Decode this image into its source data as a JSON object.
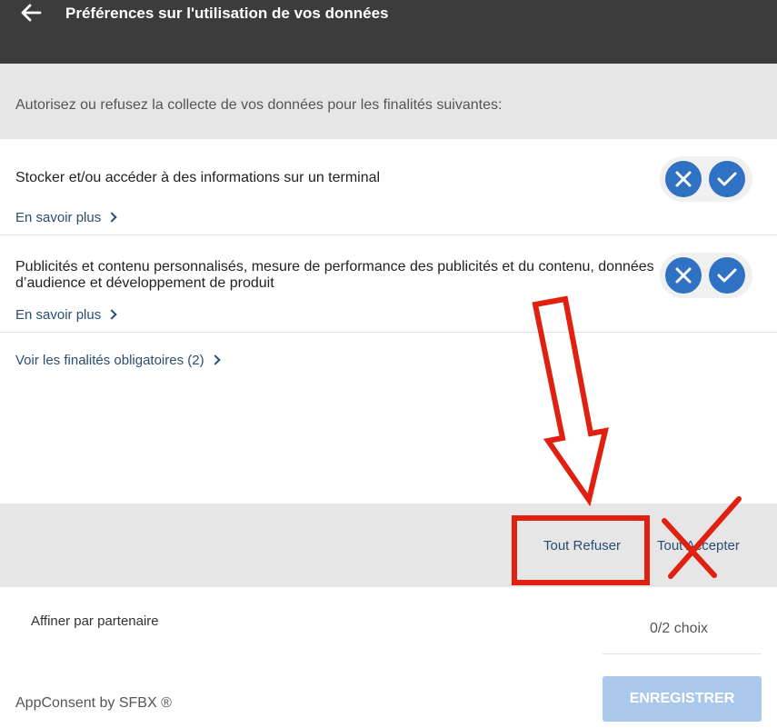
{
  "header": {
    "back_icon": "arrow-left-icon",
    "title": "Préférences sur l'utilisation de vos données",
    "background_color": "#3c3c3c"
  },
  "intro": {
    "text": "Autorisez ou refusez la collecte de vos données pour les finalités suivantes:"
  },
  "purposes": [
    {
      "title": "Stocker et/ou accéder à des informations sur un terminal",
      "learn_more": "En savoir plus",
      "refuse_icon": "close-icon",
      "accept_icon": "check-icon"
    },
    {
      "title": "Publicités et contenu personnalisés, mesure de performance des publicités et du contenu, données d’audience et développement de produit",
      "learn_more": "En savoir plus",
      "refuse_icon": "close-icon",
      "accept_icon": "check-icon"
    }
  ],
  "mandatory_link": "Voir les finalités obligatoires (2)",
  "actions": {
    "refuse_all": "Tout Refuser",
    "accept_all": "Tout Accepter"
  },
  "footer": {
    "refine_label": "Affiner par partenaire",
    "choice_count": "0/2 choix",
    "save_label": "ENREGISTRER",
    "brand": "AppConsent by SFBX ®"
  },
  "colors": {
    "toggle_blue": "#2f72c4",
    "link_blue": "#2a4d73",
    "save_button": "#a9c8ec",
    "annotation_red": "#e02010"
  },
  "annotations": [
    "down-arrow-annotation",
    "highlight-box-annotation",
    "cross-out-annotation"
  ]
}
